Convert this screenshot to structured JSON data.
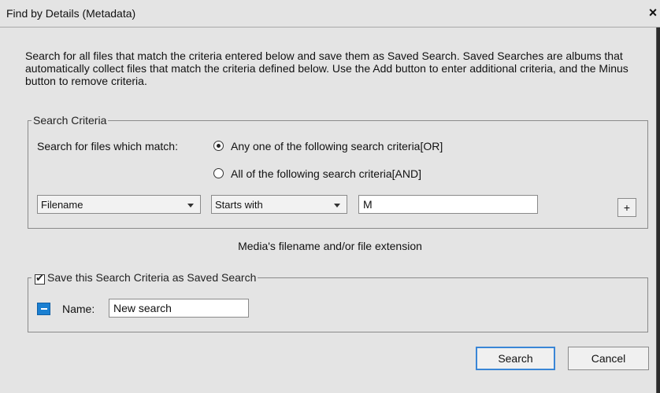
{
  "dialog": {
    "title": "Find by Details (Metadata)",
    "close_glyph": "×",
    "description": "Search for all files that match the criteria entered below and save them as Saved Search. Saved Searches are albums that automatically collect files that match the criteria defined below. Use the Add button to enter additional criteria, and the Minus button to remove criteria."
  },
  "criteria": {
    "legend": "Search Criteria",
    "match_label": "Search for files which match:",
    "option_any": "Any one of the following search criteria[OR]",
    "option_all": "All of the following search criteria[AND]",
    "selected_option": "any",
    "field_select": "Filename",
    "operator_select": "Starts with",
    "value": "M",
    "add_label": "+",
    "hint": "Media's filename and/or file extension"
  },
  "save": {
    "legend": "Save this Search Criteria as Saved Search",
    "checked": true,
    "name_label": "Name:",
    "name_value": "New search"
  },
  "buttons": {
    "search": "Search",
    "cancel": "Cancel"
  },
  "colors": {
    "accent": "#3a86d6",
    "album_icon": "#1a7fd1"
  },
  "icons": {
    "album": "album-icon",
    "close": "close-icon"
  }
}
